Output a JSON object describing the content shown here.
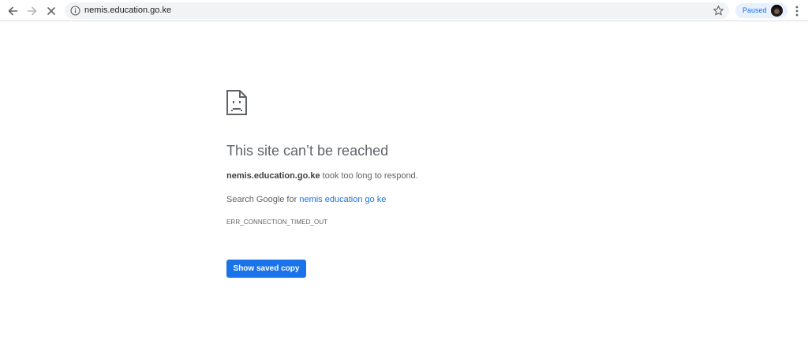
{
  "browser": {
    "url": "nemis.education.go.ke",
    "profile_chip_label": "Paused",
    "icons": {
      "back": "arrow-back-icon",
      "forward": "arrow-forward-icon",
      "stop": "close-icon",
      "site_info": "info-icon",
      "bookmark": "star-icon",
      "menu": "vertical-dots-icon"
    },
    "colors": {
      "omnibox_bg": "#f1f3f4",
      "chip_bg": "#e8f0fe",
      "chip_text": "#1a73e8"
    }
  },
  "error_page": {
    "icon": "sad-document-icon",
    "title": "This site can’t be reached",
    "host": "nemis.education.go.ke",
    "host_suffix": " took too long to respond.",
    "search_prefix": "Search Google for ",
    "search_link": "nemis education go ke",
    "error_code": "ERR_CONNECTION_TIMED_OUT",
    "button_label": "Show saved copy",
    "colors": {
      "text": "#5f6368",
      "link": "#1a73e8",
      "button_bg": "#1a73e8"
    }
  }
}
